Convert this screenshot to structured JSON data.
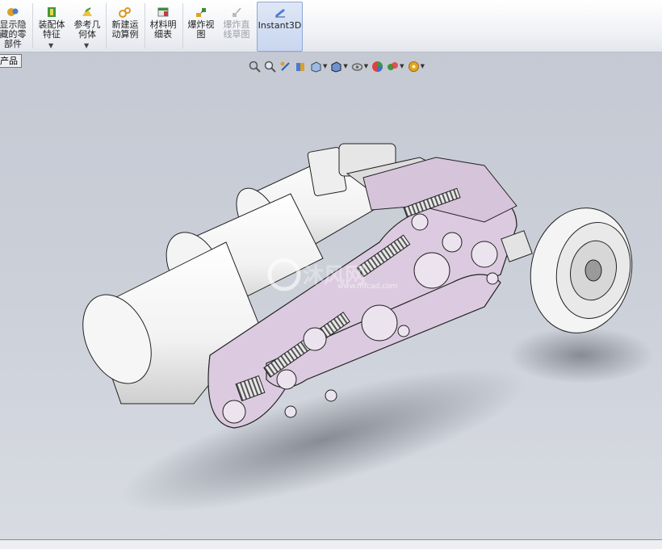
{
  "toolbar": {
    "items": [
      {
        "label": "显示隐\n藏的零\n部件",
        "icon": "show-hidden-components-icon"
      },
      {
        "label": "装配体\n特征",
        "icon": "assembly-features-icon"
      },
      {
        "label": "参考几\n何体",
        "icon": "reference-geometry-icon"
      },
      {
        "label": "新建运\n动算例",
        "icon": "new-motion-study-icon"
      },
      {
        "label": "材料明\n细表",
        "icon": "bill-of-materials-icon"
      },
      {
        "label": "爆炸视\n图",
        "icon": "exploded-view-icon"
      },
      {
        "label": "爆炸直\n线草图",
        "icon": "explode-line-sketch-icon"
      },
      {
        "label": "Instant3D",
        "icon": "instant3d-icon"
      }
    ]
  },
  "tree_tab": {
    "label": "产品"
  },
  "view_tools": [
    "zoom-to-fit-icon",
    "zoom-to-area-icon",
    "previous-view-icon",
    "section-view-icon",
    "view-orientation-icon",
    "display-style-icon",
    "hide-show-items-icon",
    "edit-appearance-icon",
    "apply-scene-icon",
    "view-settings-icon"
  ],
  "watermark": {
    "text": "沐风网",
    "sub": "www.mfcad.com"
  },
  "colors": {
    "plate": "#dccbe0",
    "viewport_top": "#c5c9d3",
    "accent": "#4a7bd0"
  }
}
